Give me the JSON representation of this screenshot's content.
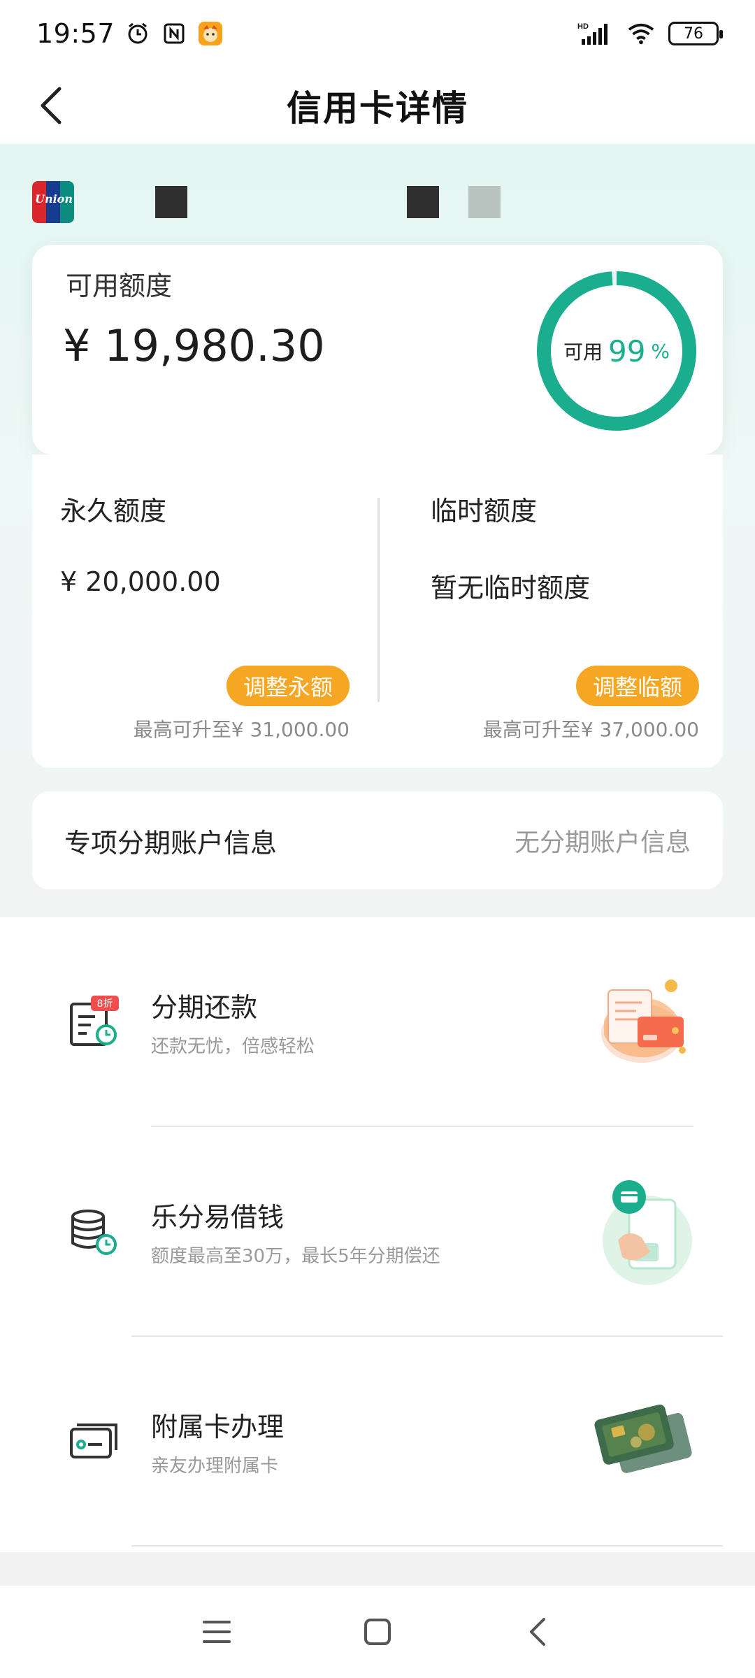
{
  "status_bar": {
    "time": "19:57",
    "battery": "76",
    "network": "HD"
  },
  "nav": {
    "title": "信用卡详情"
  },
  "available": {
    "label": "可用额度",
    "amount": "¥ 19,980.30",
    "ring_label": "可用",
    "ring_value": "99",
    "ring_unit": "%",
    "percent": 99,
    "ring_color": "#1aae8e"
  },
  "limits": {
    "permanent": {
      "title": "永久额度",
      "value": "¥ 20,000.00",
      "button": "调整永额",
      "max_text": "最高可升至¥ 31,000.00"
    },
    "temporary": {
      "title": "临时额度",
      "value": "暂无临时额度",
      "button": "调整临额",
      "max_text": "最高可升至¥ 37,000.00"
    },
    "button_color": "#f5a623"
  },
  "installment_account": {
    "title": "专项分期账户信息",
    "value": "无分期账户信息"
  },
  "services": [
    {
      "title": "分期还款",
      "desc": "还款无忧，倍感轻松",
      "badge": "8折",
      "icon": "installment-repay-icon"
    },
    {
      "title": "乐分易借钱",
      "desc": "额度最高至30万，最长5年分期偿还",
      "icon": "coins-clock-icon"
    },
    {
      "title": "附属卡办理",
      "desc": "亲友办理附属卡",
      "icon": "card-icon"
    }
  ],
  "card_brand": "UnionPay"
}
